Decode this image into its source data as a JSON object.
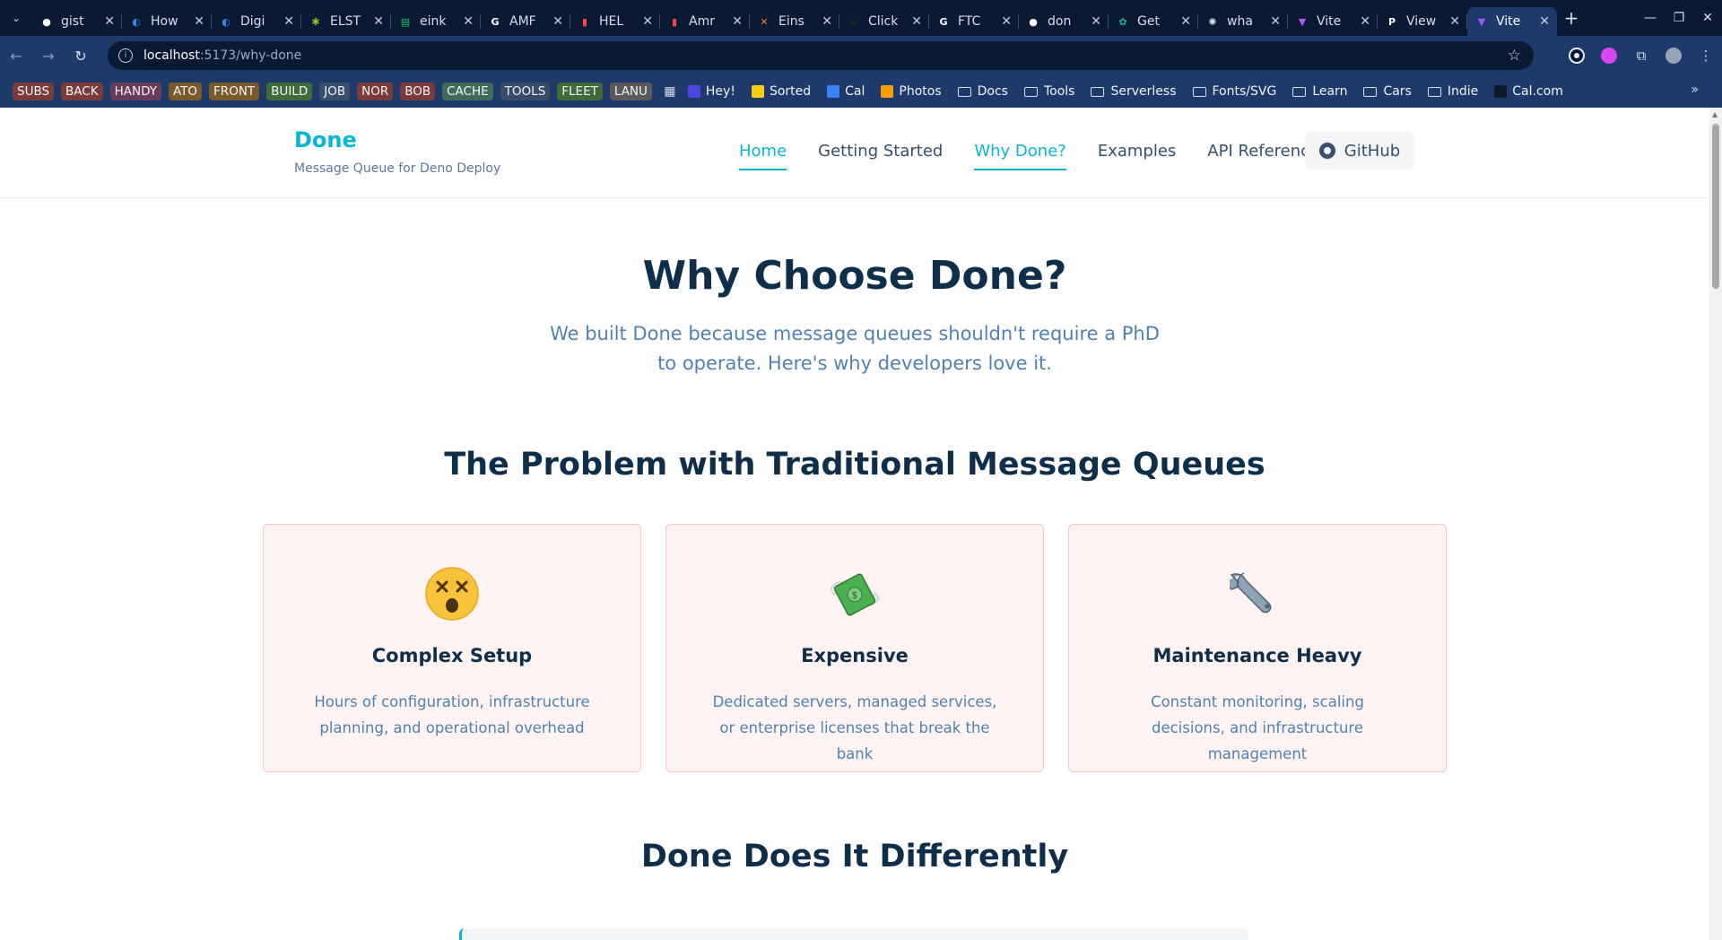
{
  "browser": {
    "tabs": [
      {
        "title": "gist",
        "fav": "github-icon",
        "color": "#ffffff"
      },
      {
        "title": "How",
        "fav": "digitalocean-icon",
        "color": "#3b82f6"
      },
      {
        "title": "Digi",
        "fav": "digitalocean-icon",
        "color": "#3b82f6"
      },
      {
        "title": "ELST",
        "fav": "star-icon",
        "color": "#84cc16"
      },
      {
        "title": "eink",
        "fav": "sheets-icon",
        "color": "#22c55e"
      },
      {
        "title": "AMF",
        "fav": "google-icon",
        "color": "#ffffff"
      },
      {
        "title": "HEL",
        "fav": "flag-icon",
        "color": "#ef4444"
      },
      {
        "title": "Amr",
        "fav": "flag-icon",
        "color": "#ef4444"
      },
      {
        "title": "Eins",
        "fav": "eins-icon",
        "color": "#f97316"
      },
      {
        "title": "Click",
        "fav": "click-icon",
        "color": "#222222"
      },
      {
        "title": "FTC",
        "fav": "google-icon",
        "color": "#ffffff"
      },
      {
        "title": "don",
        "fav": "github-icon",
        "color": "#ffffff"
      },
      {
        "title": "Get",
        "fav": "openai-icon",
        "color": "#10b981"
      },
      {
        "title": "wha",
        "fav": "gear-icon",
        "color": "#d7deea"
      },
      {
        "title": "Vite",
        "fav": "vite-icon",
        "color": "#a855f7"
      },
      {
        "title": "View",
        "fav": "paypal-icon",
        "color": "#ffffff"
      },
      {
        "title": "Vite",
        "fav": "vite-icon",
        "color": "#a855f7",
        "active": true
      }
    ],
    "url": {
      "host": "localhost",
      "rest": ":5173/why-done"
    },
    "bookmark_tags": [
      {
        "label": "SUBS",
        "color": "#7a3b3b"
      },
      {
        "label": "BACK",
        "color": "#7a3b3b"
      },
      {
        "label": "HANDY",
        "color": "#6b3b5a"
      },
      {
        "label": "ATO",
        "color": "#7a5a2b"
      },
      {
        "label": "FRONT",
        "color": "#7a5a2b"
      },
      {
        "label": "BUILD",
        "color": "#3f6b3a"
      },
      {
        "label": "JOB",
        "color": "#3a4f6b"
      },
      {
        "label": "NOR",
        "color": "#7a3b3b"
      },
      {
        "label": "BOB",
        "color": "#7a3b3b"
      },
      {
        "label": "CACHE",
        "color": "#3f6b5a"
      },
      {
        "label": "TOOLS",
        "color": "#3a4a6b"
      },
      {
        "label": "FLEET",
        "color": "#3f6b3a"
      },
      {
        "label": "LANU",
        "color": "#5a5a5a"
      }
    ],
    "bookmarks": [
      {
        "label": "Hey!",
        "icon": "hey-icon",
        "kind": "link"
      },
      {
        "label": "Sorted",
        "icon": "sorted-icon",
        "kind": "link"
      },
      {
        "label": "Cal",
        "icon": "calendar-icon",
        "kind": "link"
      },
      {
        "label": "Photos",
        "icon": "photos-icon",
        "kind": "link"
      },
      {
        "label": "Docs",
        "icon": "folder-icon",
        "kind": "folder"
      },
      {
        "label": "Tools",
        "icon": "folder-icon",
        "kind": "folder"
      },
      {
        "label": "Serverless",
        "icon": "folder-icon",
        "kind": "folder"
      },
      {
        "label": "Fonts/SVG",
        "icon": "folder-icon",
        "kind": "folder"
      },
      {
        "label": "Learn",
        "icon": "folder-icon",
        "kind": "folder"
      },
      {
        "label": "Cars",
        "icon": "folder-icon",
        "kind": "folder"
      },
      {
        "label": "Indie",
        "icon": "folder-icon",
        "kind": "folder"
      },
      {
        "label": "Cal.com",
        "icon": "calcom-icon",
        "kind": "link"
      }
    ]
  },
  "site": {
    "brand": "Done",
    "tagline": "Message Queue for Deno Deploy",
    "nav": [
      {
        "label": "Home",
        "current": true
      },
      {
        "label": "Getting Started",
        "current": false
      },
      {
        "label": "Why Done?",
        "current": true
      },
      {
        "label": "Examples",
        "current": false
      },
      {
        "label": "API Reference",
        "current": false
      }
    ],
    "github_label": "GitHub",
    "accent": "#06b6d4"
  },
  "hero": {
    "title": "Why Choose Done?",
    "subtitle": "We built Done because message queues shouldn't require a PhD to operate. Here's why developers love it."
  },
  "problems": {
    "title": "The Problem with Traditional Message Queues",
    "cards": [
      {
        "icon": "dizzy-face-icon",
        "title": "Complex Setup",
        "desc": "Hours of configuration, infrastructure planning, and operational overhead"
      },
      {
        "icon": "money-wings-icon",
        "title": "Expensive",
        "desc": "Dedicated servers, managed services, or enterprise licenses that break the bank"
      },
      {
        "icon": "wrench-icon",
        "title": "Maintenance Heavy",
        "desc": "Constant monitoring, scaling decisions, and infrastructure management"
      }
    ]
  },
  "differently": {
    "title": "Done Does It Differently"
  }
}
